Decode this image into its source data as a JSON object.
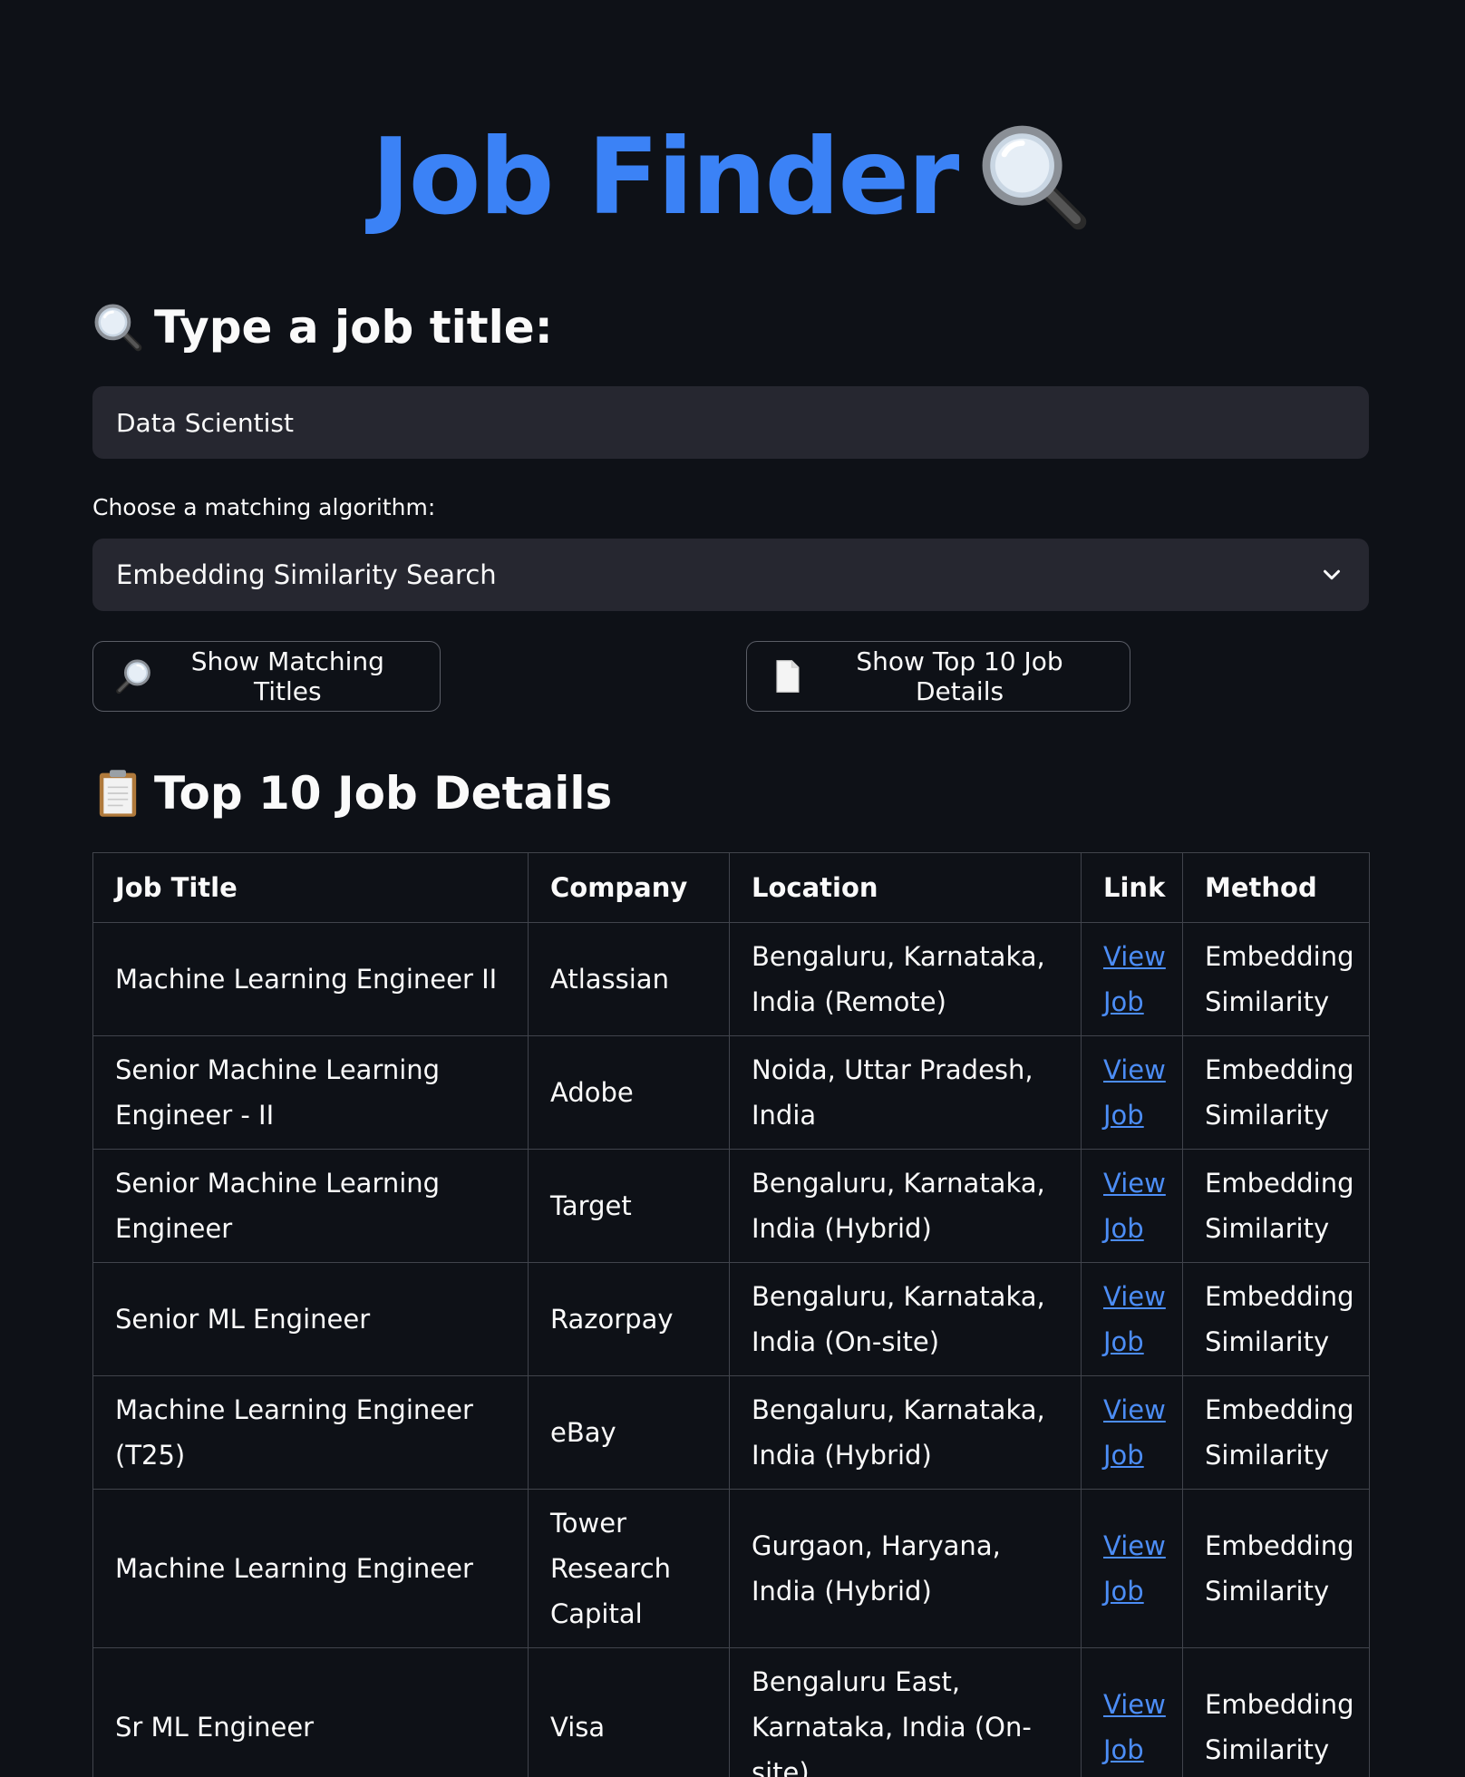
{
  "app": {
    "title": "Job Finder",
    "title_icon": "magnifier-icon"
  },
  "search": {
    "heading": "Type a job title:",
    "heading_icon": "magnifier-icon",
    "value": "Data Scientist"
  },
  "algorithm": {
    "label": "Choose a matching algorithm:",
    "selected": "Embedding Similarity Search"
  },
  "buttons": {
    "matching_titles": "Show Matching Titles",
    "matching_titles_icon": "magnifier-icon",
    "top_details": "Show Top 10 Job Details",
    "top_details_icon": "page-icon"
  },
  "results": {
    "heading": "Top 10 Job Details",
    "heading_icon": "clipboard-icon",
    "columns": [
      "Job Title",
      "Company",
      "Location",
      "Link",
      "Method"
    ],
    "rows": [
      {
        "title": "Machine Learning Engineer II",
        "company": "Atlassian",
        "location": "Bengaluru, Karnataka, India (Remote)",
        "link": "View Job",
        "method": "Embedding Similarity"
      },
      {
        "title": "Senior Machine Learning Engineer - II",
        "company": "Adobe",
        "location": "Noida, Uttar Pradesh, India",
        "link": "View Job",
        "method": "Embedding Similarity"
      },
      {
        "title": "Senior Machine Learning Engineer",
        "company": "Target",
        "location": "Bengaluru, Karnataka, India (Hybrid)",
        "link": "View Job",
        "method": "Embedding Similarity"
      },
      {
        "title": "Senior ML Engineer",
        "company": "Razorpay",
        "location": "Bengaluru, Karnataka, India (On-site)",
        "link": "View Job",
        "method": "Embedding Similarity"
      },
      {
        "title": "Machine Learning Engineer (T25)",
        "company": "eBay",
        "location": "Bengaluru, Karnataka, India (Hybrid)",
        "link": "View Job",
        "method": "Embedding Similarity"
      },
      {
        "title": "Machine Learning Engineer",
        "company": "Tower Research Capital",
        "location": "Gurgaon, Haryana, India (Hybrid)",
        "link": "View Job",
        "method": "Embedding Similarity"
      },
      {
        "title": "Sr ML Engineer",
        "company": "Visa",
        "location": "Bengaluru East, Karnataka, India (On-site)",
        "link": "View Job",
        "method": "Embedding Similarity"
      }
    ]
  }
}
